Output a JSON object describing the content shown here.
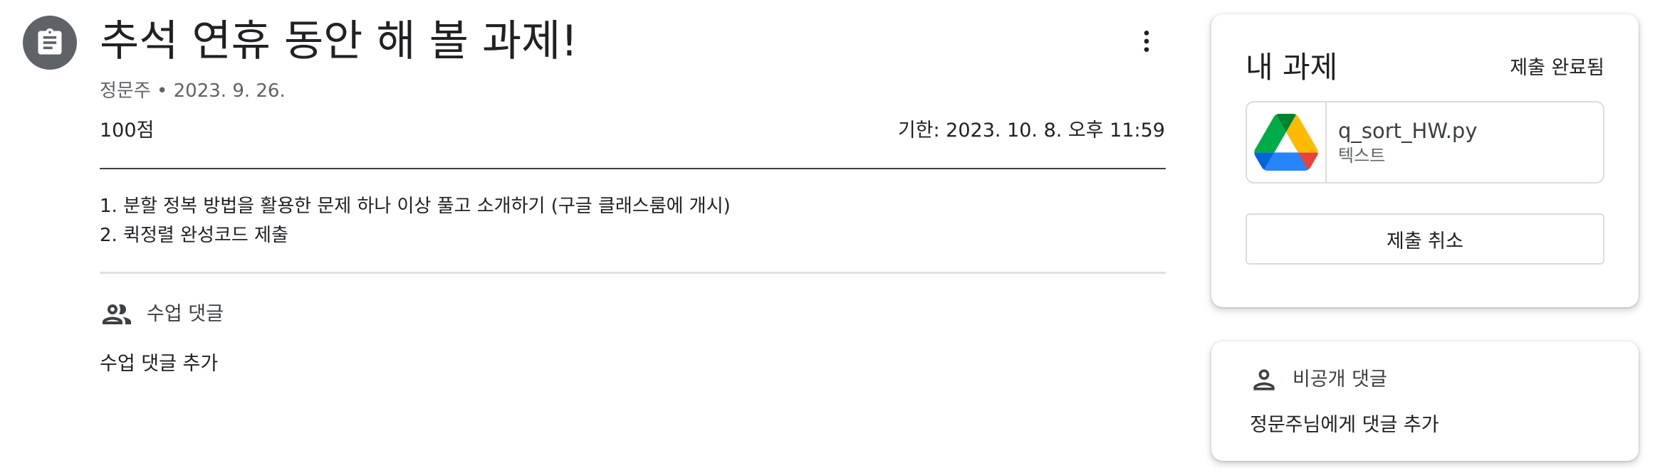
{
  "assignment": {
    "icon": "assignment-icon",
    "title": "추석 연휴 동안 해 볼 과제!",
    "meta": "정문주 • 2023. 9. 26.",
    "points": "100점",
    "due": "기한: 2023. 10. 8. 오후 11:59",
    "instructions": [
      "1. 분할 정복 방법을 활용한 문제 하나 이상 풀고 소개하기 (구글 클래스룸에 개시)",
      "2. 퀵정렬 완성코드 제출"
    ],
    "more_icon": "more-vert-icon"
  },
  "class_comments": {
    "icon": "people-icon",
    "label": "수업 댓글",
    "add_label": "수업 댓글 추가"
  },
  "your_work": {
    "title": "내 과제",
    "status": "제출 완료됨",
    "attachment": {
      "icon": "google-drive-icon",
      "name": "q_sort_HW.py",
      "type": "텍스트"
    },
    "unsubmit_label": "제출 취소"
  },
  "private_comments": {
    "icon": "person-icon",
    "label": "비공개 댓글",
    "add_label": "정문주님에게 댓글 추가"
  },
  "colors": {
    "icon_bg": "#5f6368",
    "text": "#202124",
    "secondary_text": "#5f6368",
    "border": "#dadce0",
    "drive_green": "#1fa463",
    "drive_yellow": "#ffd04b",
    "drive_blue": "#4688f4",
    "drive_red": "#ea4335"
  }
}
